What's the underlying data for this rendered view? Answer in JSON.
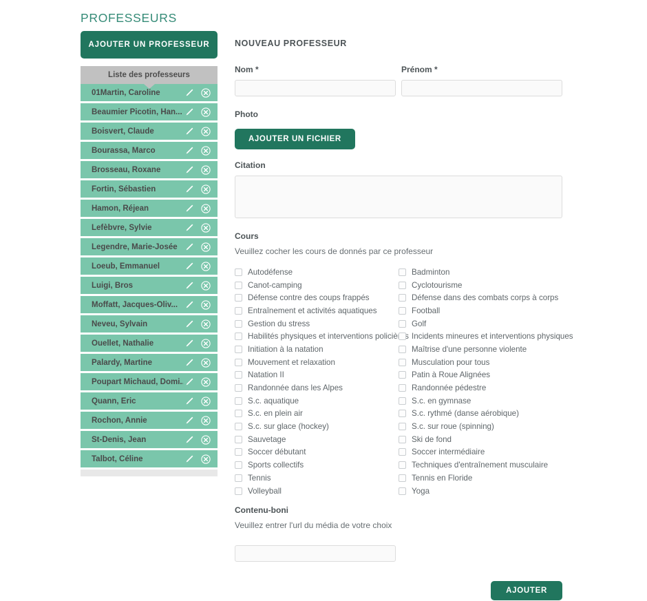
{
  "page": {
    "title": "PROFESSEURS"
  },
  "sidebar": {
    "add_button_label": "AJOUTER UN PROFESSEUR",
    "list_header": "Liste des professeurs",
    "edit_icon": "pencil-icon",
    "delete_icon": "circle-x-icon",
    "professors": [
      "01Martin, Caroline",
      "Beaumier Picotin, Han...",
      "Boisvert, Claude",
      "Bourassa, Marco",
      "Brosseau, Roxane",
      "Fortin, Sébastien",
      "Hamon, Réjean",
      "Lefèbvre, Sylvie",
      "Legendre, Marie-Josée",
      "Loeub, Emmanuel",
      "Luigi, Bros",
      "Moffatt, Jacques-Oliv...",
      "Neveu, Sylvain",
      "Ouellet, Nathalie",
      "Palardy, Martine",
      "Poupart Michaud, Domi...",
      "Quann, Éric",
      "Rochon, Annie",
      "St-Denis, Jean",
      "Talbot, Céline"
    ]
  },
  "form": {
    "title": "NOUVEAU PROFESSEUR",
    "nom_label": "Nom *",
    "nom_value": "",
    "prenom_label": "Prénom *",
    "prenom_value": "",
    "photo_label": "Photo",
    "photo_button_label": "AJOUTER UN FICHIER",
    "citation_label": "Citation",
    "citation_value": "",
    "cours_label": "Cours",
    "cours_helper": "Veuillez cocher les cours de donnés par ce professeur",
    "courses_left": [
      "Autodéfense",
      "Canot-camping",
      "Défense contre des coups frappés",
      "Entraînement et activités aquatiques",
      "Gestion du stress",
      "Habilités physiques et interventions policières",
      "Initiation à la natation",
      "Mouvement et relaxation",
      "Natation II",
      "Randonnée dans les Alpes",
      "S.c. aquatique",
      "S.c. en plein air",
      "S.c. sur glace (hockey)",
      "Sauvetage",
      "Soccer débutant",
      "Sports collectifs",
      "Tennis",
      "Volleyball"
    ],
    "courses_right": [
      "Badminton",
      "Cyclotourisme",
      "Défense dans des combats corps à corps",
      "Football",
      "Golf",
      "Incidents mineures et interventions physiques",
      "Maîtrise d'une personne violente",
      "Musculation pour tous",
      "Patin à Roue Alignées",
      "Randonnée pédestre",
      "S.c. en gymnase",
      "S.c. rythmé (danse aérobique)",
      "S.c. sur roue (spinning)",
      "Ski de fond",
      "Soccer intermédiaire",
      "Techniques d'entraînement musculaire",
      "Tennis en Floride",
      "Yoga"
    ],
    "contenu_boni_label": "Contenu-boni",
    "contenu_boni_helper": "Veuillez entrer l'url du média de votre choix",
    "contenu_boni_value": "",
    "submit_label": "AJOUTER"
  },
  "colors": {
    "brand_dark_green": "#21765e",
    "list_item_green": "#7ac6ab",
    "title_teal": "#358b77",
    "list_header_grey": "#c1c1c1"
  }
}
